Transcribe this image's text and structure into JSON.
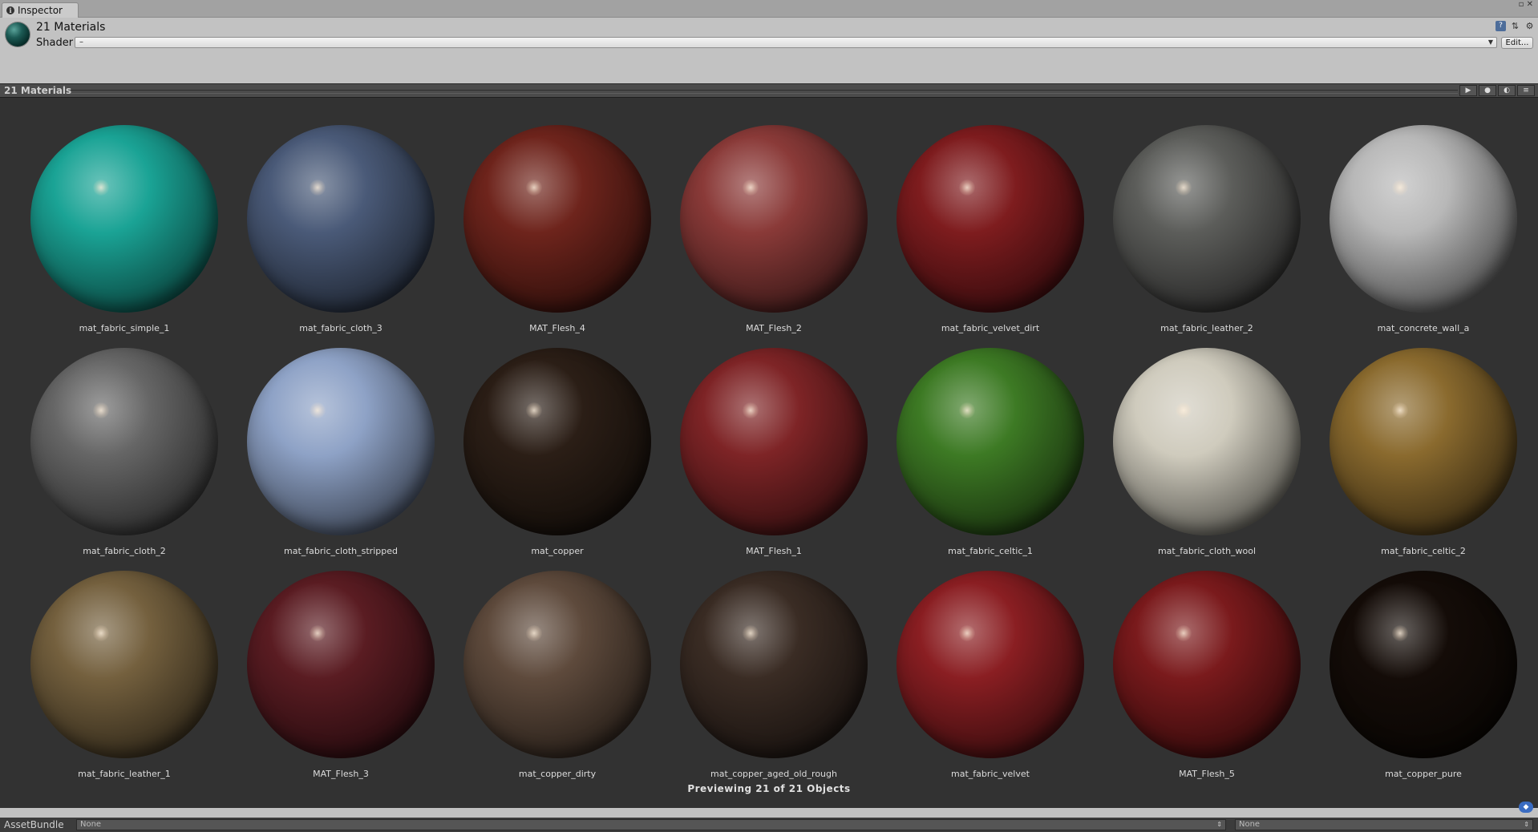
{
  "tab": {
    "label": "Inspector"
  },
  "window_controls": {
    "icon": "window-controls-icon",
    "glyph": "▫ ✕"
  },
  "header": {
    "title": "21 Materials",
    "shader_label": "Shader",
    "shader_value": "–",
    "edit_label": "Edit...",
    "icons": [
      "help-book-icon",
      "preset-sliders-icon",
      "settings-gear-icon"
    ]
  },
  "preview": {
    "title": "21 Materials",
    "count_text": "Previewing 21 of 21 Objects",
    "buttons": [
      "play-icon",
      "preview-shape-icon",
      "lighting-icon",
      "preview-menu-icon"
    ]
  },
  "materials": [
    {
      "name": "mat_fabric_simple_1",
      "color": "#1aa395"
    },
    {
      "name": "mat_fabric_cloth_3",
      "color": "#4a5a78"
    },
    {
      "name": "MAT_Flesh_4",
      "color": "#6e241c"
    },
    {
      "name": "MAT_Flesh_2",
      "color": "#8a3a38"
    },
    {
      "name": "mat_fabric_velvet_dirt",
      "color": "#7e1c1e"
    },
    {
      "name": "mat_fabric_leather_2",
      "color": "#5c5d5a"
    },
    {
      "name": "mat_concrete_wall_a",
      "color": "#b8b8b8"
    },
    {
      "name": "mat_fabric_cloth_2",
      "color": "#666666"
    },
    {
      "name": "mat_fabric_cloth_stripped",
      "color": "#8ea2c6"
    },
    {
      "name": "mat_copper",
      "color": "#2b1e16"
    },
    {
      "name": "MAT_Flesh_1",
      "color": "#7e2426"
    },
    {
      "name": "mat_fabric_celtic_1",
      "color": "#3d7a24"
    },
    {
      "name": "mat_fabric_cloth_wool",
      "color": "#cfcbbd"
    },
    {
      "name": "mat_fabric_celtic_2",
      "color": "#8a6a2e"
    },
    {
      "name": "mat_fabric_leather_1",
      "color": "#74603e"
    },
    {
      "name": "MAT_Flesh_3",
      "color": "#5a1c22"
    },
    {
      "name": "mat_copper_dirty",
      "color": "#5e4a3c"
    },
    {
      "name": "mat_copper_aged_old_rough",
      "color": "#3a2c24"
    },
    {
      "name": "mat_fabric_velvet",
      "color": "#8a1e22"
    },
    {
      "name": "MAT_Flesh_5",
      "color": "#7a1a1c"
    },
    {
      "name": "mat_copper_pure",
      "color": "#140c08"
    }
  ],
  "tag_icon": "asset-label-tag-icon",
  "footer": {
    "label": "AssetBundle",
    "bundle_value": "None",
    "variant_value": "None"
  }
}
